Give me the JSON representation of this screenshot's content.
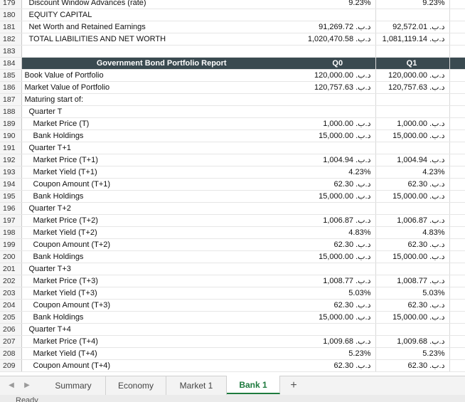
{
  "rows": [
    {
      "n": "179",
      "label": "Discount Window Advances (rate)",
      "indent": 1,
      "q0": "9.23%",
      "q1": "9.23%"
    },
    {
      "n": "180",
      "label": "EQUITY CAPITAL",
      "indent": 1,
      "q0": "",
      "q1": ""
    },
    {
      "n": "181",
      "label": "Net Worth and Retained Earnings",
      "indent": 1,
      "q0": "د.ب.‏ 91,269.72",
      "q1": "د.ب.‏ 92,572.01"
    },
    {
      "n": "182",
      "label": "TOTAL LIABILITIES AND NET WORTH",
      "indent": 1,
      "q0": "د.ب.‏ 1,020,470.58",
      "q1": "د.ب.‏ 1,081,119.14"
    },
    {
      "n": "183",
      "label": "",
      "indent": 0,
      "q0": "",
      "q1": ""
    },
    {
      "n": "184",
      "label": "Government Bond Portfolio Report",
      "indent": 0,
      "q0": "Q0",
      "q1": "Q1",
      "header": true
    },
    {
      "n": "185",
      "label": "Book Value of Portfolio",
      "indent": 0,
      "q0": "د.ب.‏ 120,000.00",
      "q1": "د.ب.‏ 120,000.00"
    },
    {
      "n": "186",
      "label": "Market Value of Portfolio",
      "indent": 0,
      "q0": "د.ب.‏ 120,757.63",
      "q1": "د.ب.‏ 120,757.63"
    },
    {
      "n": "187",
      "label": "Maturing start of:",
      "indent": 0,
      "q0": "",
      "q1": ""
    },
    {
      "n": "188",
      "label": "Quarter T",
      "indent": 1,
      "q0": "",
      "q1": ""
    },
    {
      "n": "189",
      "label": "Market Price (T)",
      "indent": 2,
      "q0": "د.ب.‏ 1,000.00",
      "q1": "د.ب.‏ 1,000.00"
    },
    {
      "n": "190",
      "label": "Bank Holdings",
      "indent": 2,
      "q0": "د.ب.‏ 15,000.00",
      "q1": "د.ب.‏ 15,000.00"
    },
    {
      "n": "191",
      "label": "Quarter T+1",
      "indent": 1,
      "q0": "",
      "q1": ""
    },
    {
      "n": "192",
      "label": "Market Price (T+1)",
      "indent": 2,
      "q0": "د.ب.‏ 1,004.94",
      "q1": "د.ب.‏ 1,004.94"
    },
    {
      "n": "193",
      "label": "Market Yield (T+1)",
      "indent": 2,
      "q0": "4.23%",
      "q1": "4.23%"
    },
    {
      "n": "194",
      "label": "Coupon Amount (T+1)",
      "indent": 2,
      "q0": "د.ب.‏ 62.30",
      "q1": "د.ب.‏ 62.30"
    },
    {
      "n": "195",
      "label": "Bank Holdings",
      "indent": 2,
      "q0": "د.ب.‏ 15,000.00",
      "q1": "د.ب.‏ 15,000.00"
    },
    {
      "n": "196",
      "label": "Quarter T+2",
      "indent": 1,
      "q0": "",
      "q1": ""
    },
    {
      "n": "197",
      "label": "Market Price (T+2)",
      "indent": 2,
      "q0": "د.ب.‏ 1,006.87",
      "q1": "د.ب.‏ 1,006.87"
    },
    {
      "n": "198",
      "label": "Market Yield (T+2)",
      "indent": 2,
      "q0": "4.83%",
      "q1": "4.83%"
    },
    {
      "n": "199",
      "label": "Coupon Amount (T+2)",
      "indent": 2,
      "q0": "د.ب.‏ 62.30",
      "q1": "د.ب.‏ 62.30"
    },
    {
      "n": "200",
      "label": "Bank Holdings",
      "indent": 2,
      "q0": "د.ب.‏ 15,000.00",
      "q1": "د.ب.‏ 15,000.00"
    },
    {
      "n": "201",
      "label": "Quarter T+3",
      "indent": 1,
      "q0": "",
      "q1": ""
    },
    {
      "n": "202",
      "label": "Market Price (T+3)",
      "indent": 2,
      "q0": "د.ب.‏ 1,008.77",
      "q1": "د.ب.‏ 1,008.77"
    },
    {
      "n": "203",
      "label": "Market Yield (T+3)",
      "indent": 2,
      "q0": "5.03%",
      "q1": "5.03%"
    },
    {
      "n": "204",
      "label": "Coupon Amount (T+3)",
      "indent": 2,
      "q0": "د.ب.‏ 62.30",
      "q1": "د.ب.‏ 62.30"
    },
    {
      "n": "205",
      "label": "Bank Holdings",
      "indent": 2,
      "q0": "د.ب.‏ 15,000.00",
      "q1": "د.ب.‏ 15,000.00"
    },
    {
      "n": "206",
      "label": "Quarter T+4",
      "indent": 1,
      "q0": "",
      "q1": ""
    },
    {
      "n": "207",
      "label": "Market Price (T+4)",
      "indent": 2,
      "q0": "د.ب.‏ 1,009.68",
      "q1": "د.ب.‏ 1,009.68"
    },
    {
      "n": "208",
      "label": "Market Yield (T+4)",
      "indent": 2,
      "q0": "5.23%",
      "q1": "5.23%"
    },
    {
      "n": "209",
      "label": "Coupon Amount (T+4)",
      "indent": 2,
      "q0": "د.ب.‏ 62.30",
      "q1": "د.ب.‏ 62.30"
    }
  ],
  "tabs": {
    "summary": "Summary",
    "economy": "Economy",
    "market1": "Market 1",
    "bank1": "Bank 1",
    "add": "+"
  },
  "nav": {
    "prev": "◀",
    "next": "▶"
  },
  "status": {
    "text": "Ready"
  },
  "colors": {
    "header_bg": "#3a4a50",
    "active_tab": "#1e7a3e"
  }
}
